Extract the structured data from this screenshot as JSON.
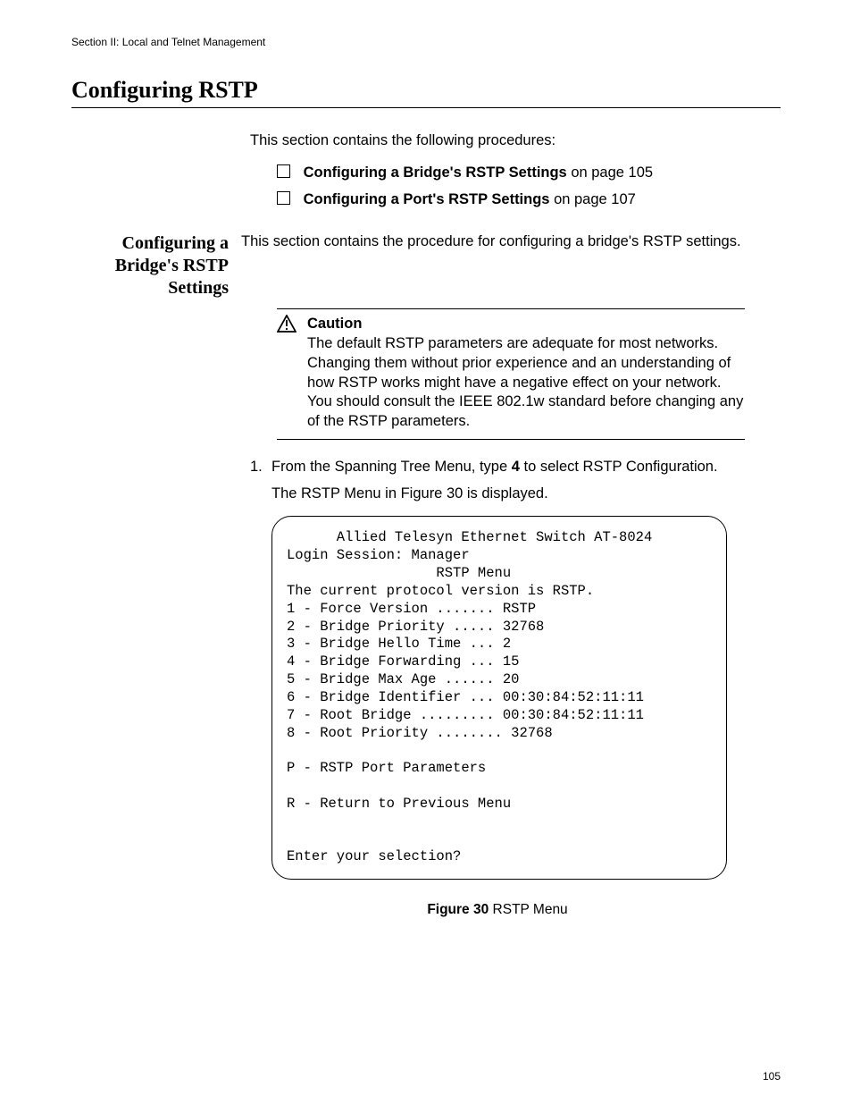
{
  "header": {
    "section_label": "Section II: Local and Telnet Management"
  },
  "title": "Configuring RSTP",
  "intro": "This section contains the following procedures:",
  "toc": [
    {
      "title": "Configuring a Bridge's RSTP Settings",
      "suffix": " on page 105"
    },
    {
      "title": "Configuring a Port's RSTP Settings",
      "suffix": " on page 107"
    }
  ],
  "side_heading": "Configuring a Bridge's RSTP Settings",
  "side_intro": "This section contains the procedure for configuring a bridge's RSTP settings.",
  "caution": {
    "label": "Caution",
    "text": "The default RSTP parameters are adequate for most networks. Changing them without prior experience and an understanding of how RSTP works might have a negative effect on your network. You should consult the IEEE 802.1w standard before changing any of the RSTP parameters."
  },
  "step1": {
    "num": "1.",
    "pre": "From the Spanning Tree Menu, type ",
    "bold": "4",
    "post": " to select RSTP Configuration."
  },
  "substep1": "The RSTP Menu in Figure 30 is displayed.",
  "terminal": {
    "header_line": "      Allied Telesyn Ethernet Switch AT-8024",
    "login_line": "Login Session: Manager",
    "menu_title": "                  RSTP Menu",
    "proto_line": "The current protocol version is RSTP.",
    "items": [
      "1 - Force Version ....... RSTP",
      "2 - Bridge Priority ..... 32768",
      "3 - Bridge Hello Time ... 2",
      "4 - Bridge Forwarding ... 15",
      "5 - Bridge Max Age ...... 20",
      "6 - Bridge Identifier ... 00:30:84:52:11:11",
      "7 - Root Bridge ......... 00:30:84:52:11:11",
      "8 - Root Priority ........ 32768"
    ],
    "p_line": "P - RSTP Port Parameters",
    "r_line": "R - Return to Previous Menu",
    "prompt": "Enter your selection?"
  },
  "figure": {
    "label": "Figure 30",
    "caption": "  RSTP Menu"
  },
  "page_number": "105"
}
